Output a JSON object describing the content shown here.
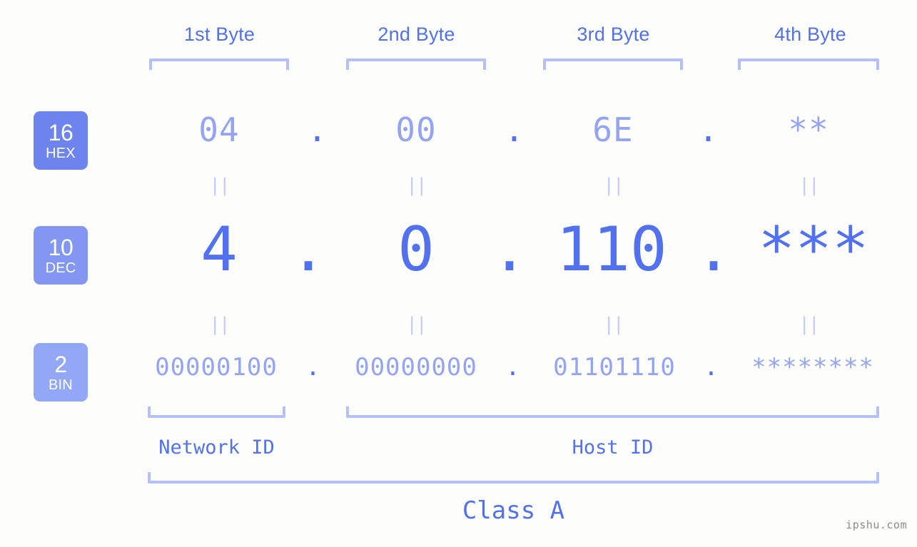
{
  "meta": {
    "watermark": "ipshu.com",
    "accent_strong": "#5271ef",
    "accent_light": "#94a4f2",
    "bracket_color": "#b5bffa",
    "background": "#fdfefb"
  },
  "byte_headers": [
    {
      "label": "1st Byte"
    },
    {
      "label": "2nd Byte"
    },
    {
      "label": "3rd Byte"
    },
    {
      "label": "4th Byte"
    }
  ],
  "bases": [
    {
      "number": "16",
      "name": "HEX",
      "color": "#6d83ee"
    },
    {
      "number": "10",
      "name": "DEC",
      "color": "#8296f2"
    },
    {
      "number": "2",
      "name": "BIN",
      "color": "#92a8f6"
    }
  ],
  "rows": {
    "hex": {
      "values": [
        "04",
        "00",
        "6E",
        "**"
      ],
      "separator": "."
    },
    "dec": {
      "values": [
        "4",
        "0",
        "110",
        "***"
      ],
      "separator": "."
    },
    "bin": {
      "values": [
        "00000100",
        "00000000",
        "01101110",
        "********"
      ],
      "separator": "."
    }
  },
  "equality_symbol": "||",
  "sections": [
    {
      "label": "Network ID"
    },
    {
      "label": "Host ID"
    }
  ],
  "class": {
    "label": "Class A"
  }
}
